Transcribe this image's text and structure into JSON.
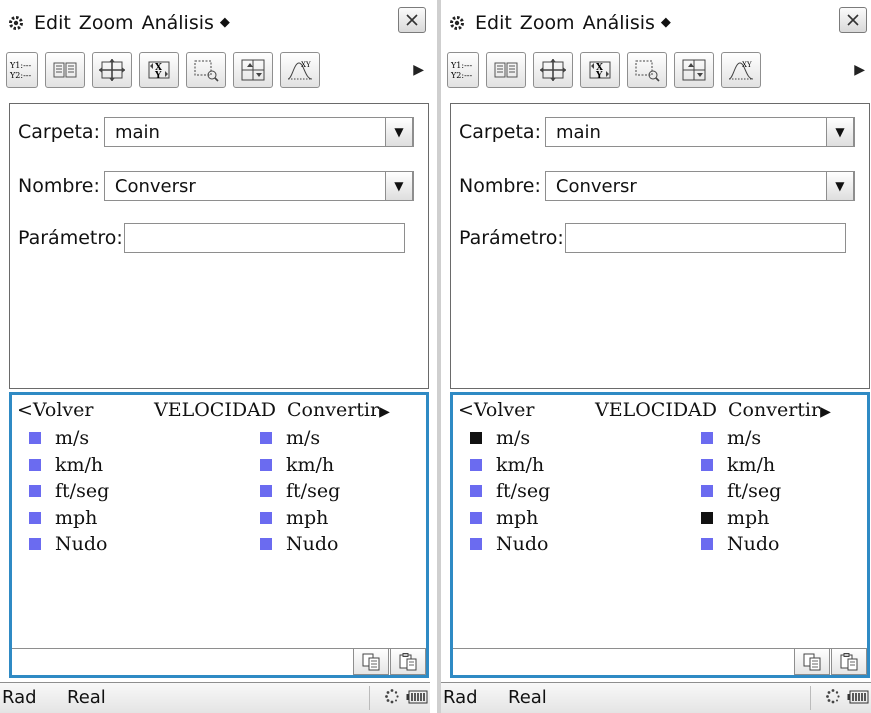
{
  "screens": [
    {
      "menu": {
        "edit": "Edit",
        "zoom": "Zoom",
        "analysis": "Análisis",
        "more": "◆"
      },
      "form": {
        "folder_label": "Carpeta:",
        "folder_value": "main",
        "name_label": "Nombre:",
        "name_value": "Conversr",
        "param_label": "Parámetro:",
        "param_value": ""
      },
      "converter": {
        "back": "<Volver",
        "title": "VELOCIDAD",
        "convert": "Convertir",
        "from_units": [
          {
            "label": "m/s",
            "selected": false
          },
          {
            "label": "km/h",
            "selected": false
          },
          {
            "label": "ft/seg",
            "selected": false
          },
          {
            "label": "mph",
            "selected": false
          },
          {
            "label": "Nudo",
            "selected": false
          }
        ],
        "to_units": [
          {
            "label": "m/s",
            "selected": false
          },
          {
            "label": "km/h",
            "selected": false
          },
          {
            "label": "ft/seg",
            "selected": false
          },
          {
            "label": "mph",
            "selected": false
          },
          {
            "label": "Nudo",
            "selected": false
          }
        ]
      },
      "status": {
        "angle": "Rad",
        "mode": "Real"
      }
    },
    {
      "menu": {
        "edit": "Edit",
        "zoom": "Zoom",
        "analysis": "Análisis",
        "more": "◆"
      },
      "form": {
        "folder_label": "Carpeta:",
        "folder_value": "main",
        "name_label": "Nombre:",
        "name_value": "Conversr",
        "param_label": "Parámetro:",
        "param_value": ""
      },
      "converter": {
        "back": "<Volver",
        "title": "VELOCIDAD",
        "convert": "Convertir",
        "from_units": [
          {
            "label": "m/s",
            "selected": true
          },
          {
            "label": "km/h",
            "selected": false
          },
          {
            "label": "ft/seg",
            "selected": false
          },
          {
            "label": "mph",
            "selected": false
          },
          {
            "label": "Nudo",
            "selected": false
          }
        ],
        "to_units": [
          {
            "label": "m/s",
            "selected": false
          },
          {
            "label": "km/h",
            "selected": false
          },
          {
            "label": "ft/seg",
            "selected": false
          },
          {
            "label": "mph",
            "selected": true
          },
          {
            "label": "Nudo",
            "selected": false
          }
        ]
      },
      "status": {
        "angle": "Rad",
        "mode": "Real"
      }
    }
  ],
  "colors": {
    "accent": "#2f8ac4",
    "unit_square": "#6b6bf0",
    "unit_square_selected": "#111111"
  },
  "icons": [
    "gear-icon",
    "close-icon",
    "graph-functions-icon",
    "table-icon",
    "zoom-box-icon",
    "xy-swap-icon",
    "zoom-window-icon",
    "split-screen-icon",
    "trace-xy-icon",
    "toolbar-next-icon",
    "dropdown-arrow-icon",
    "copy-icon",
    "paste-icon",
    "busy-icon",
    "battery-icon"
  ]
}
